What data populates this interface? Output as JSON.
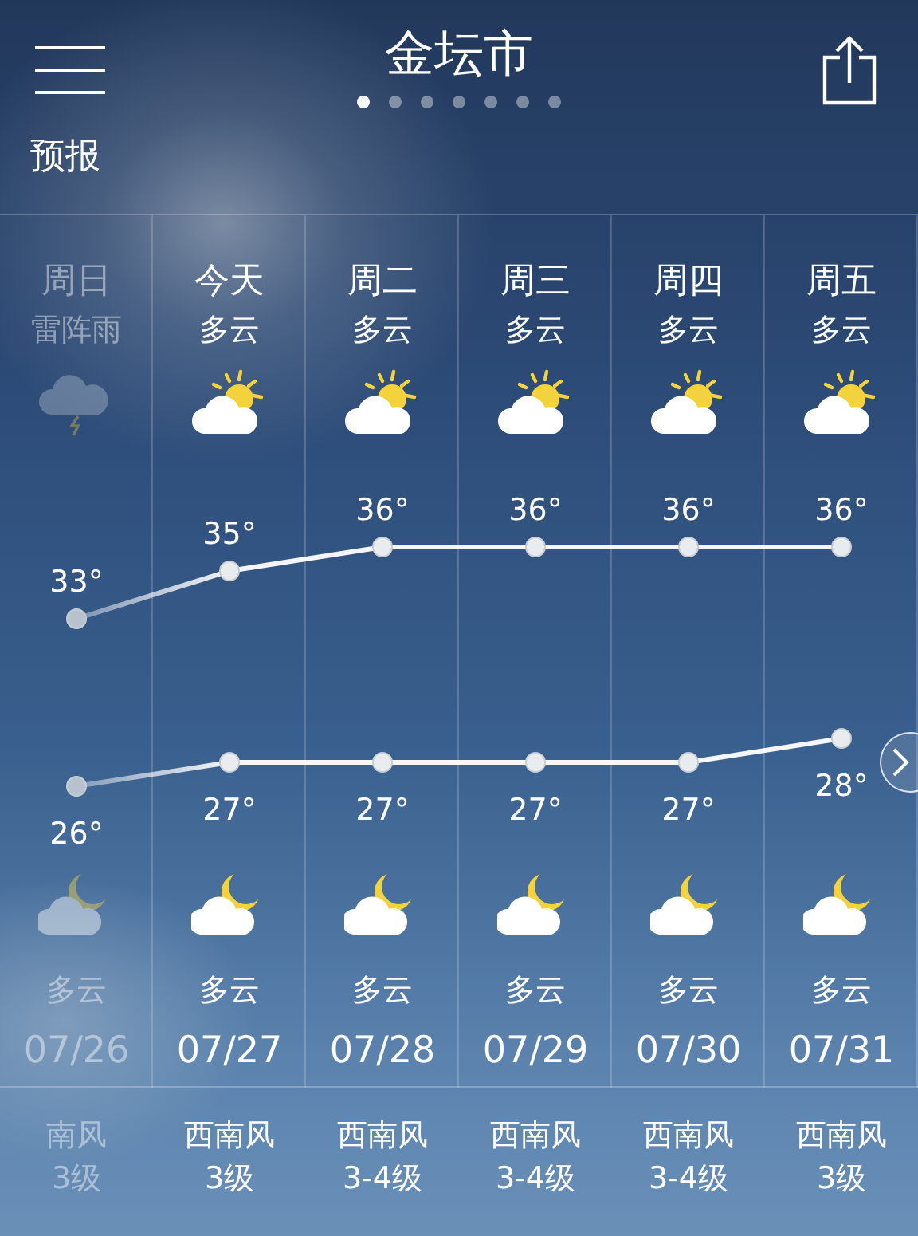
{
  "header": {
    "title": "金坛市",
    "page_dots": [
      {
        "selected": true
      },
      {
        "selected": false
      },
      {
        "selected": false
      },
      {
        "selected": false
      },
      {
        "selected": false
      },
      {
        "selected": false
      },
      {
        "selected": false
      }
    ],
    "section": "预报"
  },
  "days": [
    {
      "name": "周日",
      "day_condition": "雷阵雨",
      "day_icon": {
        "kind": "thunderstorm"
      },
      "high": "33°",
      "low": "26°",
      "night_icon": {
        "kind": "cloudy-night"
      },
      "night_condition": "多云",
      "date": "07/26",
      "wind": "南风",
      "wind_level": "3级",
      "past": true
    },
    {
      "name": "今天",
      "day_condition": "多云",
      "day_icon": {
        "kind": "partly-cloudy"
      },
      "high": "35°",
      "low": "27°",
      "night_icon": {
        "kind": "cloudy-night"
      },
      "night_condition": "多云",
      "date": "07/27",
      "wind": "西南风",
      "wind_level": "3级",
      "past": false
    },
    {
      "name": "周二",
      "day_condition": "多云",
      "day_icon": {
        "kind": "partly-cloudy"
      },
      "high": "36°",
      "low": "27°",
      "night_icon": {
        "kind": "cloudy-night"
      },
      "night_condition": "多云",
      "date": "07/28",
      "wind": "西南风",
      "wind_level": "3-4级",
      "past": false
    },
    {
      "name": "周三",
      "day_condition": "多云",
      "day_icon": {
        "kind": "partly-cloudy"
      },
      "high": "36°",
      "low": "27°",
      "night_icon": {
        "kind": "cloudy-night"
      },
      "night_condition": "多云",
      "date": "07/29",
      "wind": "西南风",
      "wind_level": "3-4级",
      "past": false
    },
    {
      "name": "周四",
      "day_condition": "多云",
      "day_icon": {
        "kind": "partly-cloudy"
      },
      "high": "36°",
      "low": "27°",
      "night_icon": {
        "kind": "cloudy-night"
      },
      "night_condition": "多云",
      "date": "07/30",
      "wind": "西南风",
      "wind_level": "3-4级",
      "past": false
    },
    {
      "name": "周五",
      "day_condition": "多云",
      "day_icon": {
        "kind": "partly-cloudy"
      },
      "high": "36°",
      "low": "28°",
      "night_icon": {
        "kind": "cloudy-night"
      },
      "night_condition": "多云",
      "date": "07/31",
      "wind": "西南风",
      "wind_level": "3级",
      "past": false
    }
  ]
}
